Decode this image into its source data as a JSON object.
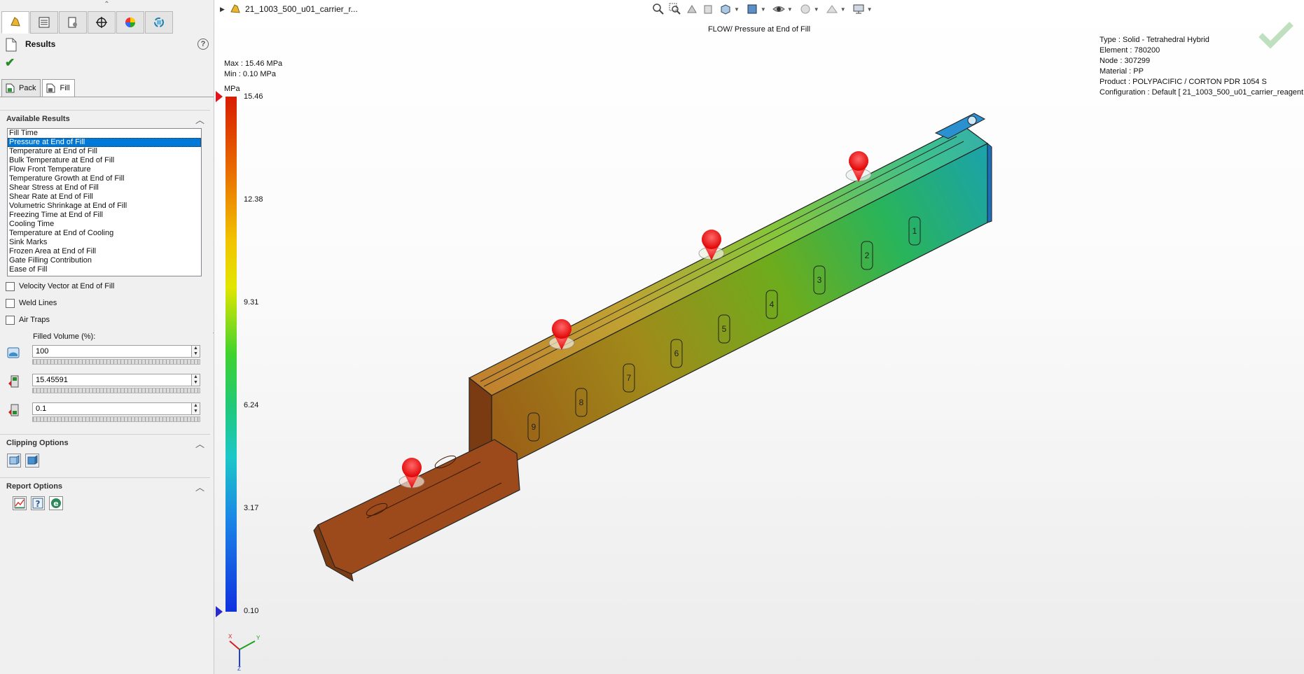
{
  "left_panel": {
    "title": "Results",
    "tabs": [
      {
        "label": "Pack"
      },
      {
        "label": "Fill"
      }
    ],
    "available_results": {
      "header": "Available Results",
      "items": [
        "Fill Time",
        "Pressure at End of Fill",
        "Temperature at End of Fill",
        "Bulk Temperature at End of Fill",
        "Flow Front Temperature",
        "Temperature Growth at End of Fill",
        "Shear Stress at End of Fill",
        "Shear Rate at End of Fill",
        "Volumetric Shrinkage at End of Fill",
        "Freezing Time at End of Fill",
        "Cooling Time",
        "Temperature at End of Cooling",
        "Sink Marks",
        "Frozen Area at End of Fill",
        "Gate Filling Contribution",
        "Ease of Fill"
      ],
      "selected": "Pressure at End of Fill"
    },
    "checkboxes": [
      {
        "label": "Velocity Vector at End of Fill",
        "checked": false
      },
      {
        "label": "Weld Lines",
        "checked": false
      },
      {
        "label": "Air Traps",
        "checked": false
      }
    ],
    "filled_volume_label": "Filled Volume (%):",
    "fields": {
      "filled_volume": "100",
      "max_value": "15.45591",
      "min_value": "0.1"
    },
    "clipping_header": "Clipping Options",
    "report_header": "Report Options"
  },
  "viewport": {
    "model_name": "21_1003_500_u01_carrier_r...",
    "plot_title": "FLOW/ Pressure at End of Fill",
    "max_text": "Max : 15.46 MPa",
    "min_text": "Min : 0.10 MPa",
    "info": {
      "type": "Type : Solid - Tetrahedral Hybrid",
      "element": "Element : 780200",
      "node": "Node : 307299",
      "material": "Material : PP",
      "product": "Product : POLYPACIFIC / CORTON PDR 1054 S",
      "configuration": "Configuration : Default [ 21_1003_500_u01_carrier_reagent..."
    },
    "legend": {
      "unit": "MPa",
      "ticks": [
        "15.46",
        "12.38",
        "9.31",
        "6.24",
        "3.17",
        "0.10"
      ]
    },
    "slot_numbers": [
      "1",
      "2",
      "3",
      "4",
      "5",
      "6",
      "7",
      "8",
      "9"
    ],
    "triad_labels": {
      "x": "X",
      "y": "Y",
      "z": "Z"
    },
    "colors": {
      "high": "#d81c00",
      "mid": "#3fd22f",
      "low": "#1030e0",
      "gate": "#ff2020"
    }
  }
}
